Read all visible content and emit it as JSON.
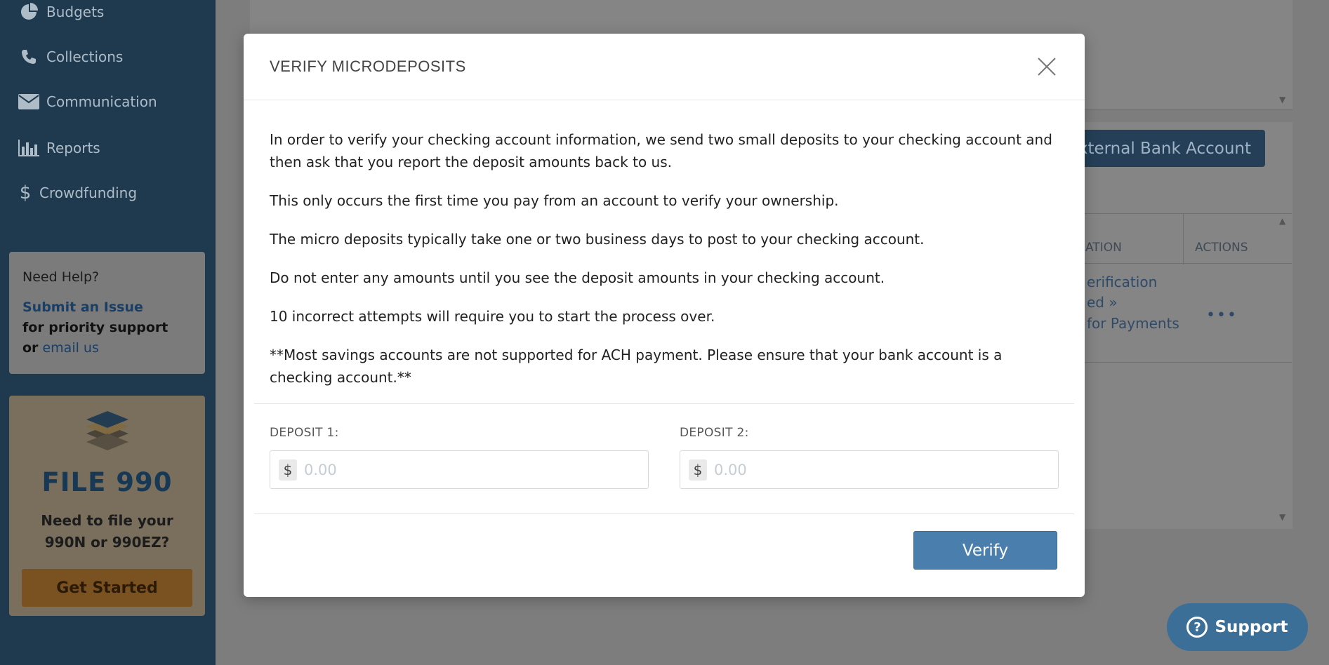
{
  "sidebar": {
    "items": [
      {
        "label": "Budgets",
        "icon": "pie-chart-icon"
      },
      {
        "label": "Collections",
        "icon": "phone-icon"
      },
      {
        "label": "Communication",
        "icon": "envelope-icon"
      },
      {
        "label": "Reports",
        "icon": "bar-chart-icon"
      },
      {
        "label": "Crowdfunding",
        "icon": "dollar-icon"
      }
    ],
    "help": {
      "title": "Need Help?",
      "submit_link": "Submit an Issue",
      "priority_text": "for priority support",
      "or_text": "or",
      "email_link": "email us"
    },
    "promo": {
      "brand": "FILE 990",
      "line1": "Need to file your",
      "line2": "990N or 990EZ?",
      "cta": "Get Started"
    }
  },
  "background": {
    "external_button": "External Bank Account",
    "table_headers": [
      "ATION",
      "ACTIONS"
    ],
    "cells": [
      "erification",
      "ed »",
      "for Payments"
    ],
    "actions_dots": "•••"
  },
  "support": {
    "label": "Support",
    "icon_glyph": "?"
  },
  "modal": {
    "title": "VERIFY MICRODEPOSITS",
    "paragraphs": [
      "In order to verify your checking account information, we send two small deposits to your checking account and then ask that you report the deposit amounts back to us.",
      "This only occurs the first time you pay from an account to verify your ownership.",
      "The micro deposits typically take one or two business days to post to your checking account.",
      "Do not enter any amounts until you see the deposit amounts in your checking account.",
      "10 incorrect attempts will require you to start the process over.",
      "**Most savings accounts are not supported for ACH payment. Please ensure that your bank account is a checking account.**"
    ],
    "deposit1": {
      "label": "DEPOSIT 1:",
      "currency": "$",
      "placeholder": "0.00",
      "value": ""
    },
    "deposit2": {
      "label": "DEPOSIT 2:",
      "currency": "$",
      "placeholder": "0.00",
      "value": ""
    },
    "verify_label": "Verify"
  },
  "colors": {
    "sidebar_bg": "#1f3a4f",
    "overlay": "#7d7d7d",
    "primary_button": "#4a7fad",
    "support_button": "#3c6f98"
  }
}
